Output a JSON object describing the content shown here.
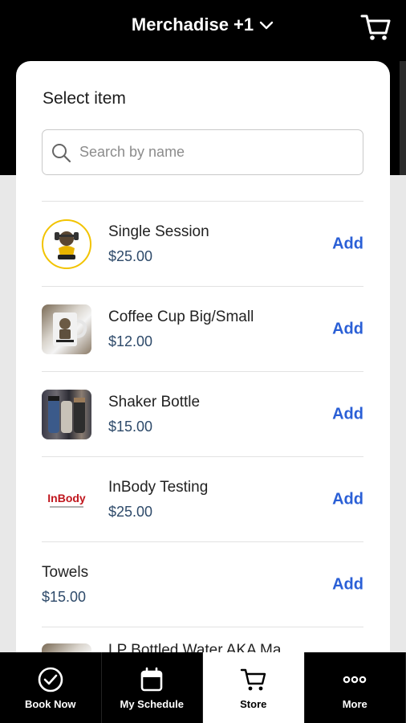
{
  "header": {
    "title": "Merchadise +1",
    "cart_icon": "cart-icon"
  },
  "sheet": {
    "title": "Select item",
    "search": {
      "placeholder": "Search by name"
    }
  },
  "items": [
    {
      "name": "Single Session",
      "price": "$25.00",
      "action": "Add",
      "thumb": "lp-fitness-logo"
    },
    {
      "name": "Coffee Cup Big/Small",
      "price": "$12.00",
      "action": "Add",
      "thumb": "coffee-cup-photo"
    },
    {
      "name": "Shaker Bottle",
      "price": "$15.00",
      "action": "Add",
      "thumb": "shaker-bottle-photo"
    },
    {
      "name": "InBody Testing",
      "price": "$25.00",
      "action": "Add",
      "thumb": "inbody-logo"
    },
    {
      "name": "Towels",
      "price": "$15.00",
      "action": "Add"
    },
    {
      "name": "LP Bottled Water AKA Ma..."
    }
  ],
  "logos": {
    "inbody": "InBody"
  },
  "nav": [
    {
      "label": "Book Now",
      "icon": "check-circle-icon"
    },
    {
      "label": "My Schedule",
      "icon": "calendar-icon"
    },
    {
      "label": "Store",
      "icon": "cart-icon",
      "active": true
    },
    {
      "label": "More",
      "icon": "more-dots-icon"
    }
  ],
  "colors": {
    "accent": "#2a5fd6",
    "price": "#2e4a6a",
    "header_bg": "#000000"
  }
}
